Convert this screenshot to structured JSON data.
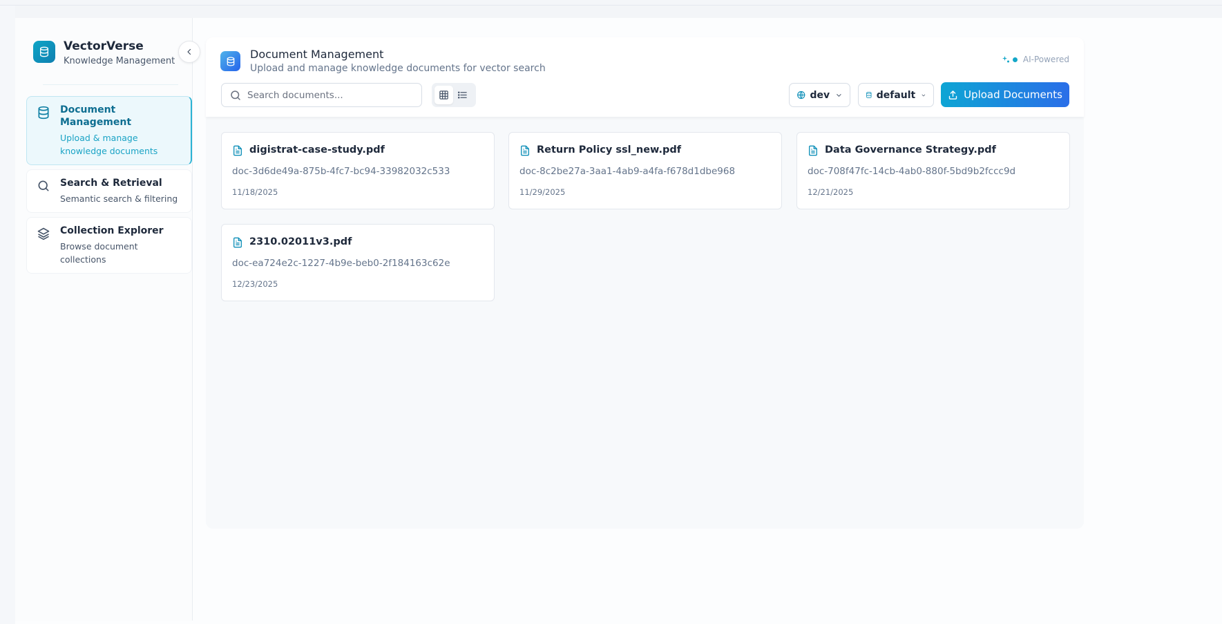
{
  "brand": {
    "name": "VectorVerse",
    "subtitle": "Knowledge Management"
  },
  "sidebar": {
    "items": [
      {
        "title": "Document Management",
        "desc": "Upload & manage knowledge documents",
        "icon": "database-icon",
        "active": true
      },
      {
        "title": "Search & Retrieval",
        "desc": "Semantic search & filtering",
        "icon": "search-icon",
        "active": false
      },
      {
        "title": "Collection Explorer",
        "desc": "Browse document collections",
        "icon": "layers-icon",
        "active": false
      }
    ]
  },
  "header": {
    "title": "Document Management",
    "subtitle": "Upload and manage knowledge documents for vector search",
    "badge": "AI-Powered"
  },
  "toolbar": {
    "search_placeholder": "Search documents...",
    "search_value": "",
    "view_modes": [
      "grid",
      "list"
    ],
    "active_view": "grid",
    "environment": "dev",
    "collection": "default",
    "upload_label": "Upload Documents"
  },
  "documents": [
    {
      "name": "digistrat-case-study.pdf",
      "id": "doc-3d6de49a-875b-4fc7-bc94-33982032c533",
      "date": "11/18/2025"
    },
    {
      "name": "Return Policy ssl_new.pdf",
      "id": "doc-8c2be27a-3aa1-4ab9-a4fa-f678d1dbe968",
      "date": "11/29/2025"
    },
    {
      "name": "Data Governance Strategy.pdf",
      "id": "doc-708f47fc-14cb-4ab0-880f-5bd9b2fccc9d",
      "date": "12/21/2025"
    },
    {
      "name": "2310.02011v3.pdf",
      "id": "doc-ea724e2c-1227-4b9e-beb0-2f184163c62e",
      "date": "12/23/2025"
    }
  ],
  "colors": {
    "accent": "#0ea5c6",
    "primary": "#2a6ee8",
    "text": "#1e293b",
    "muted": "#64748b"
  }
}
